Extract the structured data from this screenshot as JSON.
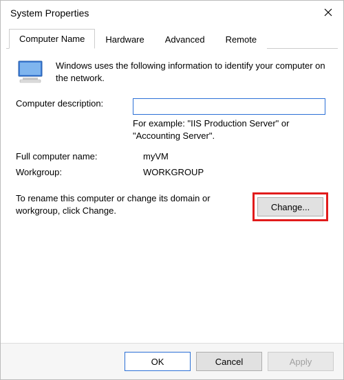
{
  "window": {
    "title": "System Properties"
  },
  "tabs": [
    {
      "label": "Computer Name"
    },
    {
      "label": "Hardware"
    },
    {
      "label": "Advanced"
    },
    {
      "label": "Remote"
    }
  ],
  "intro": "Windows uses the following information to identify your computer on the network.",
  "fields": {
    "description_label": "Computer description:",
    "description_value": "",
    "example_text": "For example: \"IIS Production Server\" or \"Accounting Server\".",
    "fullname_label": "Full computer name:",
    "fullname_value": "myVM",
    "workgroup_label": "Workgroup:",
    "workgroup_value": "WORKGROUP"
  },
  "change": {
    "text": "To rename this computer or change its domain or workgroup, click Change.",
    "button_label": "Change..."
  },
  "buttons": {
    "ok": "OK",
    "cancel": "Cancel",
    "apply": "Apply"
  }
}
